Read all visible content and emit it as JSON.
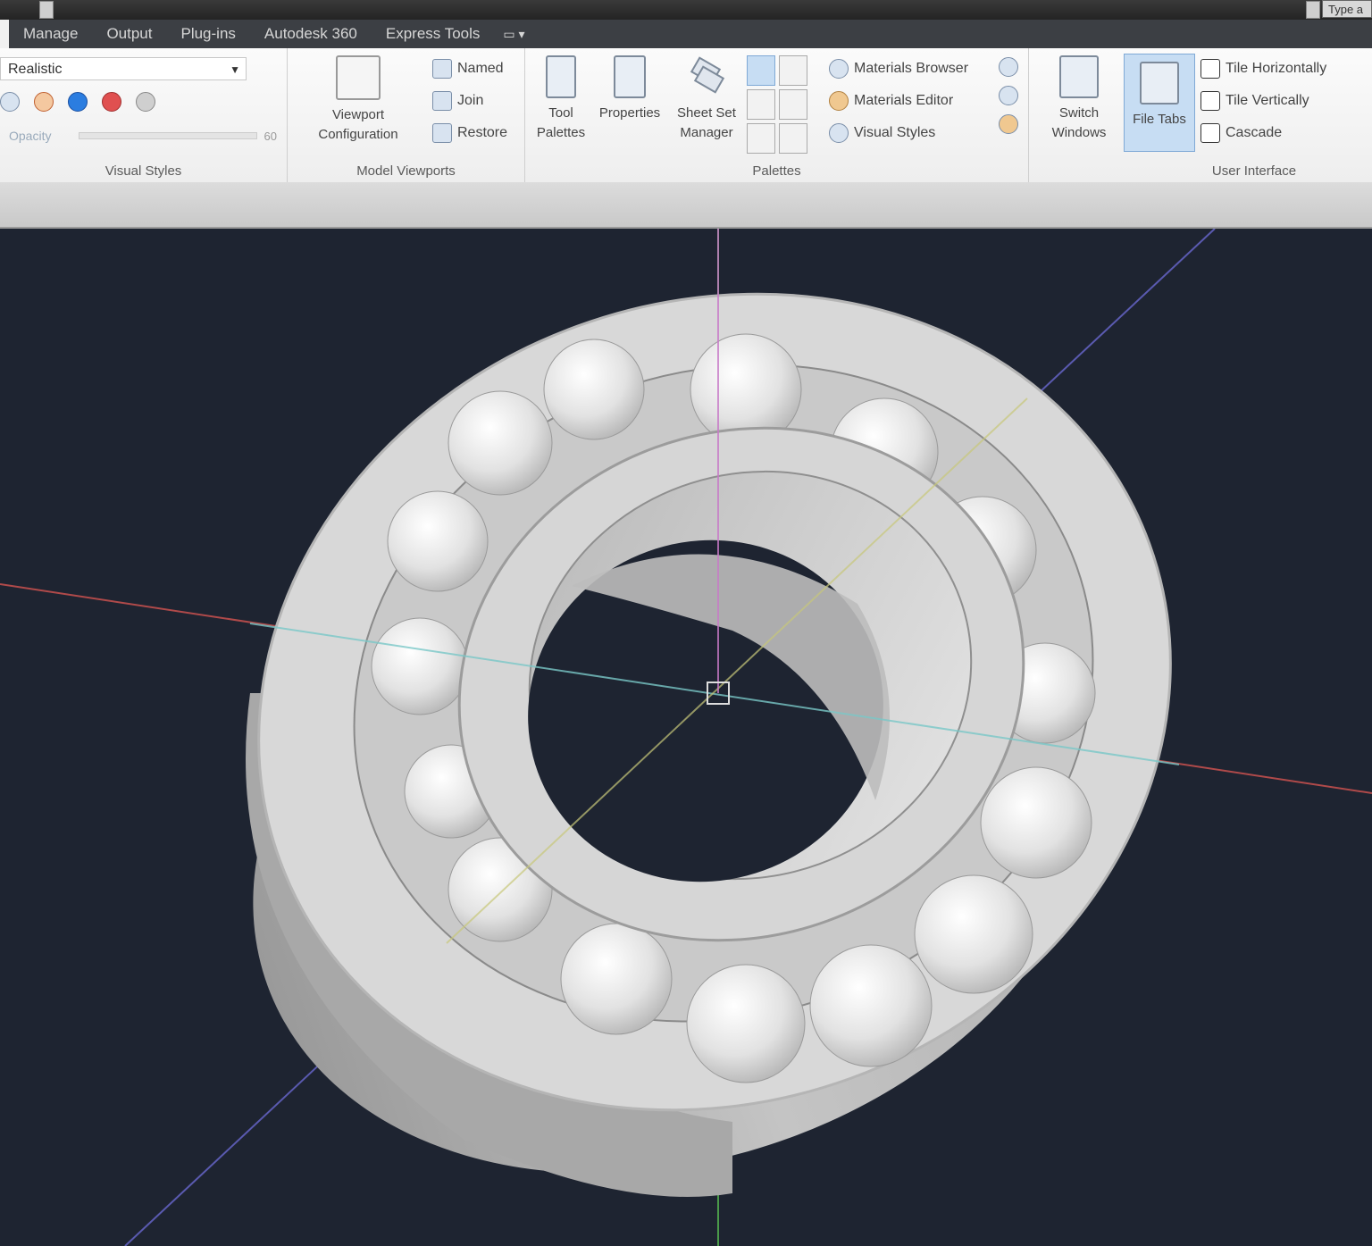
{
  "search": {
    "placeholder": "Type a"
  },
  "tabs": [
    "Manage",
    "Output",
    "Plug-ins",
    "Autodesk 360",
    "Express Tools"
  ],
  "ribbon": {
    "visual_styles": {
      "title": "Visual Styles",
      "current_style": "Realistic",
      "opacity_label": "Opacity",
      "opacity_value": "60"
    },
    "model_viewports": {
      "title": "Model Viewports",
      "config_line1": "Viewport",
      "config_line2": "Configuration",
      "named": "Named",
      "join": "Join",
      "restore": "Restore"
    },
    "palettes": {
      "title": "Palettes",
      "tool_line1": "Tool",
      "tool_line2": "Palettes",
      "properties": "Properties",
      "sheet_line1": "Sheet Set",
      "sheet_line2": "Manager",
      "materials_browser": "Materials Browser",
      "materials_editor": "Materials Editor",
      "visual_styles": "Visual Styles"
    },
    "user_interface": {
      "title": "User Interface",
      "switch_line1": "Switch",
      "switch_line2": "Windows",
      "file_tabs": "File Tabs",
      "tile_h": "Tile Horizontally",
      "tile_v": "Tile Vertically",
      "cascade": "Cascade"
    }
  },
  "viewport": {
    "background": "#1e2431",
    "axis_colors": {
      "x": "#b04a4a",
      "y": "#4a9a4a",
      "z": "#5a5ab0",
      "cyan": "#7ac8c8",
      "yellow": "#c8c87a",
      "magenta": "#c87ac8"
    },
    "model": "ball-bearing"
  }
}
